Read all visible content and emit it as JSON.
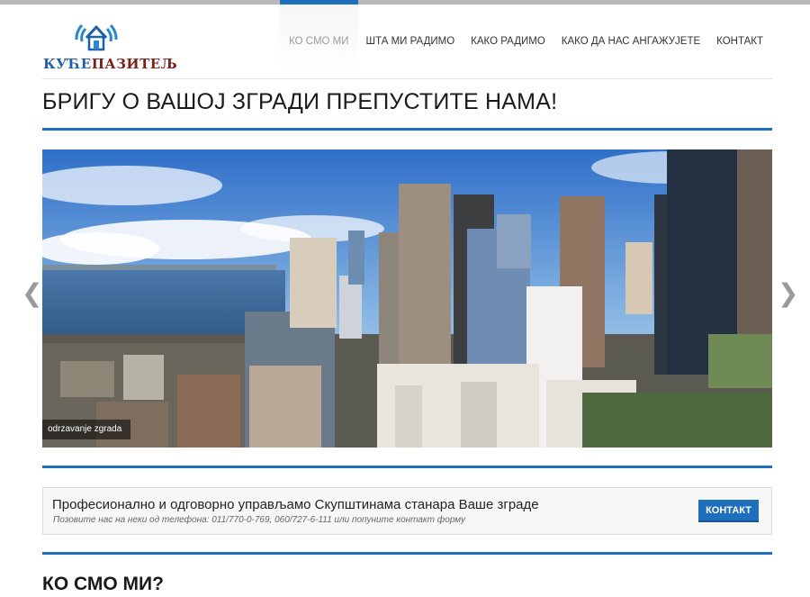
{
  "brand": {
    "logo_text_part1": "КУЋЕ",
    "logo_text_part2": "ПАЗИТЕЉ",
    "colors": {
      "primary": "#1f6fbf",
      "logo_blue": "#1f5fa8",
      "logo_red": "#7a2018"
    }
  },
  "nav": {
    "items": [
      {
        "label": "КО СМО МИ",
        "active": true
      },
      {
        "label": "ШТА МИ РАДИМО",
        "active": false
      },
      {
        "label": "КАКО РАДИМО",
        "active": false
      },
      {
        "label": "КАКО ДА НАС АНГАЖУЈЕТЕ",
        "active": false
      },
      {
        "label": "КОНТАКТ",
        "active": false
      }
    ]
  },
  "hero": {
    "title": "БРИГУ О ВАШОЈ ЗГРАДИ ПРЕПУСТИТЕ НАМА!",
    "slider": {
      "caption": "odrzavanje zgrada",
      "prev_icon": "chevron-left-icon",
      "next_icon": "chevron-right-icon"
    }
  },
  "callout": {
    "title": "Професионално и одговорно управљамо Скупштинама станара Ваше зграде",
    "subtitle": "Позовите нас на неки од телефона: 011/770-0-769, 060/727-6-111 или попуните контакт форму",
    "button_label": "КОНТАКТ"
  },
  "section": {
    "title": "КО СМО МИ?"
  }
}
